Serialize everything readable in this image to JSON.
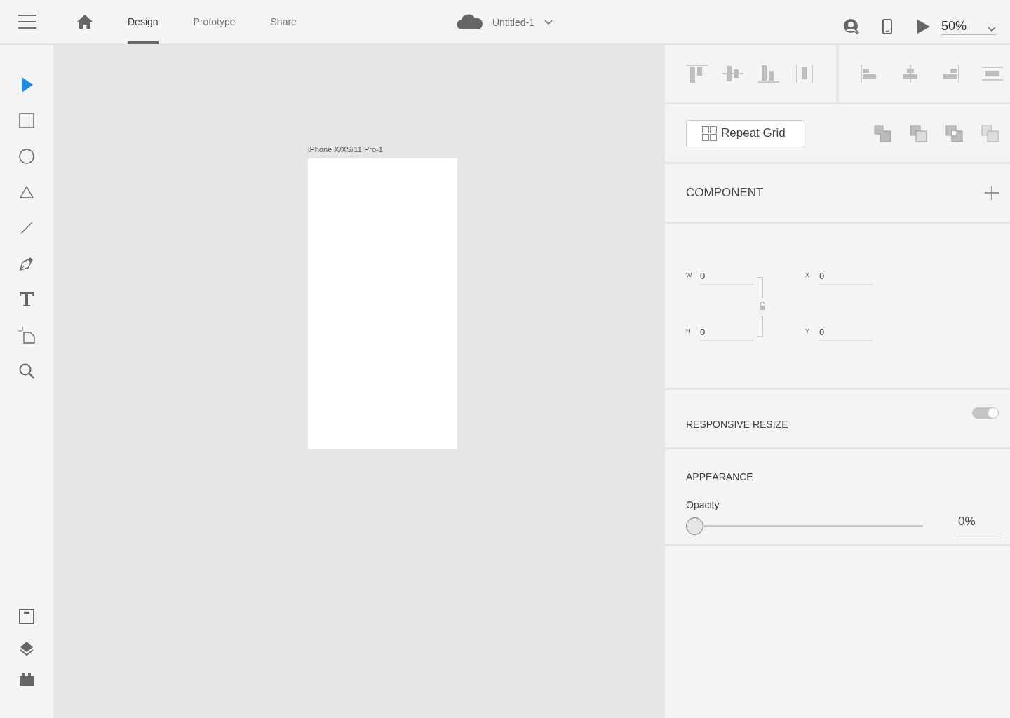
{
  "top_bar": {
    "tabs": [
      {
        "label": "Design",
        "selected": true
      },
      {
        "label": "Prototype",
        "selected": false
      },
      {
        "label": "Share",
        "selected": false
      }
    ],
    "document_title": "Untitled-1",
    "zoom": "50%"
  },
  "tools": [
    {
      "kind": "select",
      "selected": true
    },
    {
      "kind": "rectangle",
      "selected": false
    },
    {
      "kind": "ellipse",
      "selected": false
    },
    {
      "kind": "triangle",
      "selected": false
    },
    {
      "kind": "line",
      "selected": false
    },
    {
      "kind": "pen",
      "selected": false
    },
    {
      "kind": "text",
      "selected": false
    },
    {
      "kind": "artboard",
      "selected": false
    },
    {
      "kind": "zoom",
      "selected": false
    }
  ],
  "bottom_tools": [
    {
      "kind": "assets"
    },
    {
      "kind": "layers"
    },
    {
      "kind": "plugins"
    }
  ],
  "artboard": {
    "label": "iPhone X/XS/11 Pro-1"
  },
  "properties": {
    "repeat_grid": "Repeat Grid",
    "component": "COMPONENT",
    "fields": [
      {
        "label": "W",
        "value": "0"
      },
      {
        "label": "H",
        "value": "0"
      },
      {
        "label": "X",
        "value": "0"
      },
      {
        "label": "Y",
        "value": "0"
      }
    ],
    "aspect_locked": false,
    "responsive_resize": {
      "label": "RESPONSIVE RESIZE",
      "on": true
    },
    "appearance": {
      "title": "APPEARANCE",
      "opacity_label": "Opacity",
      "opacity": {
        "level": 0,
        "reading": "0%"
      }
    }
  }
}
